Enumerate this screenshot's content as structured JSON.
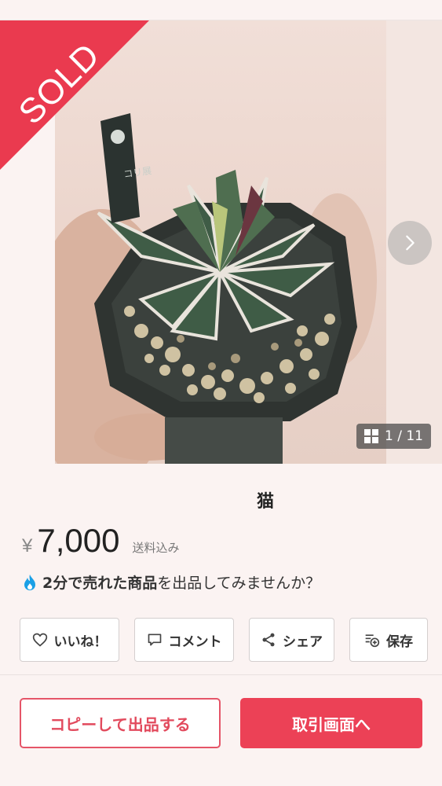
{
  "gallery": {
    "sold_label": "SOLD",
    "counter": "1 / 11",
    "next_icon": "chevron-right-icon",
    "tag_text": "コリ展"
  },
  "product": {
    "title": "猫",
    "currency": "¥",
    "price": "7,000",
    "shipping": "送料込み"
  },
  "promo": {
    "icon": "fire-icon",
    "bold": "2分で売れた商品",
    "rest": "を出品してみませんか？"
  },
  "actions": {
    "like": "いいね！",
    "comment": "コメント",
    "share": "シェア",
    "save": "保存"
  },
  "footer": {
    "copy_button": "コピーして出品する",
    "trade_button": "取引画面へ"
  },
  "colors": {
    "accent": "#ec4156",
    "sold_ribbon": "#ea3a4f",
    "promo_icon": "#1aa0e6"
  }
}
